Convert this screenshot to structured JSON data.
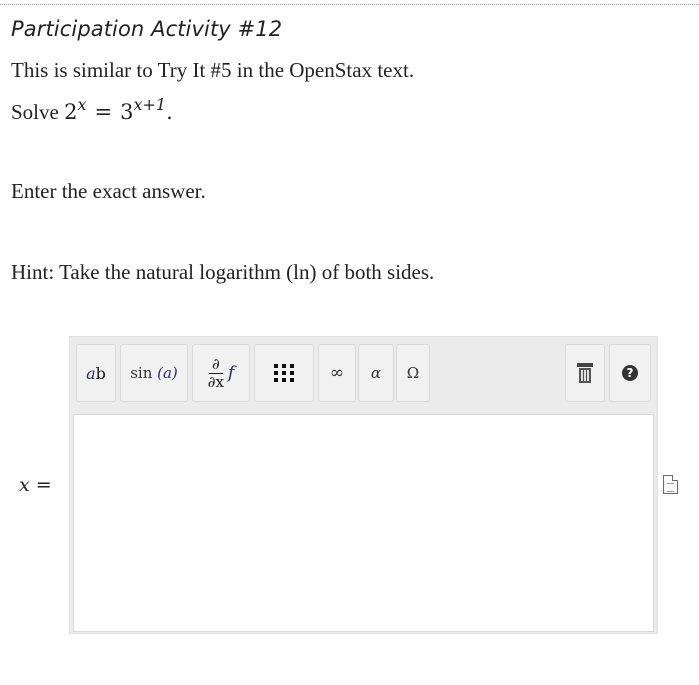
{
  "header": {
    "title": "Participation Activity #12"
  },
  "problem": {
    "line1": "This is similar to Try It #5 in the OpenStax text.",
    "solve_prefix": "Solve",
    "eq_left_base": "2",
    "eq_left_exp": "x",
    "eq_equals": "=",
    "eq_right_base": "3",
    "eq_right_exp": "x+1",
    "eq_period": ".",
    "instruction": "Enter the exact answer.",
    "hint": "Hint: Take the natural logarithm (ln) of both sides."
  },
  "toolbar": {
    "power_base": "a",
    "power_exp": "b",
    "trig_label": "sin",
    "trig_arg": "(a)",
    "deriv_num": "∂",
    "deriv_den": "∂x",
    "deriv_f": "f",
    "infinity": "∞",
    "alpha": "α",
    "omega": "Ω",
    "help": "?"
  },
  "answer": {
    "variable": "x",
    "equals": "=",
    "value": ""
  }
}
